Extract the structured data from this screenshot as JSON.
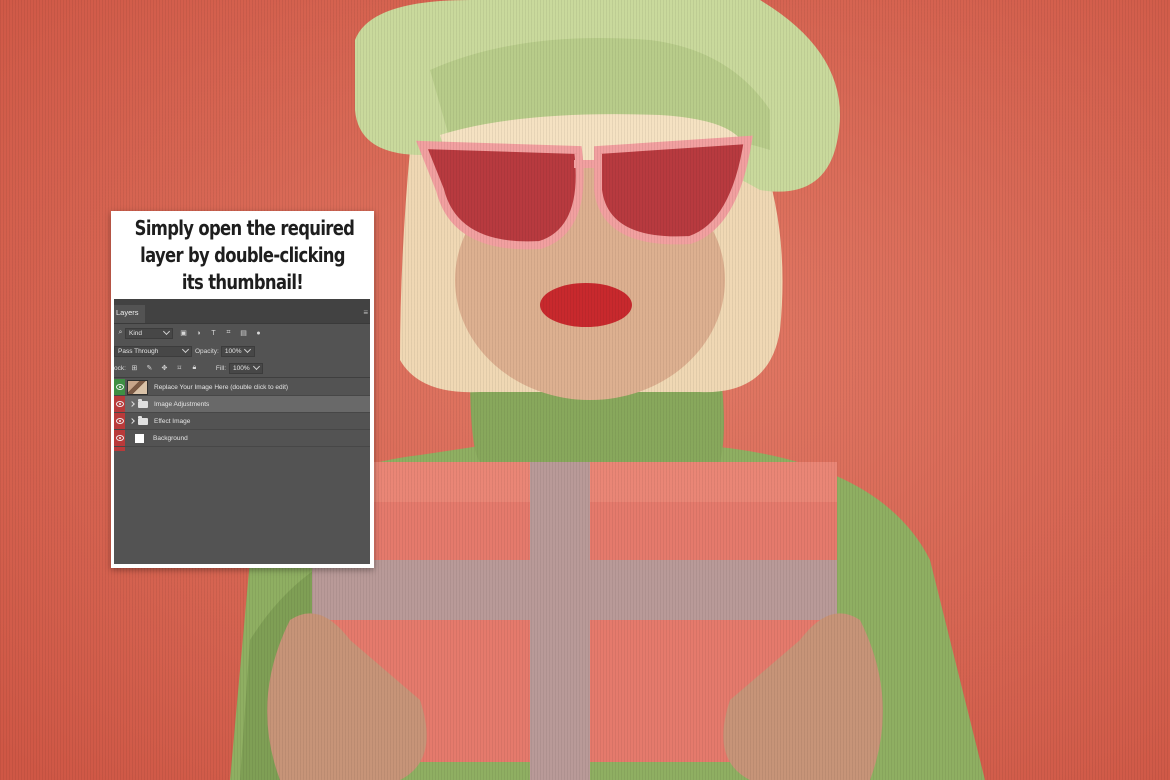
{
  "caption": {
    "line1": "Simply open the required",
    "line2": "layer by double-clicking",
    "line3": "its thumbnail!"
  },
  "layers_panel": {
    "tab_label": "Layers",
    "filter_kind": "Kind",
    "blend_mode": "Pass Through",
    "opacity_label": "Opacity:",
    "opacity_value": "100%",
    "lock_label": "ock:",
    "fill_label": "Fill:",
    "fill_value": "100%",
    "layers": [
      {
        "name": "Replace Your Image Here (double click to edit)",
        "type": "smart-object",
        "visible": true,
        "selected": false
      },
      {
        "name": "Image Adjustments",
        "type": "group",
        "visible": true,
        "selected": true
      },
      {
        "name": "Effect Image",
        "type": "group",
        "visible": true,
        "selected": false
      },
      {
        "name": "Background",
        "type": "layer",
        "visible": true,
        "selected": false
      }
    ]
  },
  "colors": {
    "background": "#d96552",
    "panel_bg": "#535353",
    "panel_header": "#424242",
    "selected_row": "#696969",
    "label_red": "#b93a3a",
    "label_green": "#3f8f43"
  }
}
